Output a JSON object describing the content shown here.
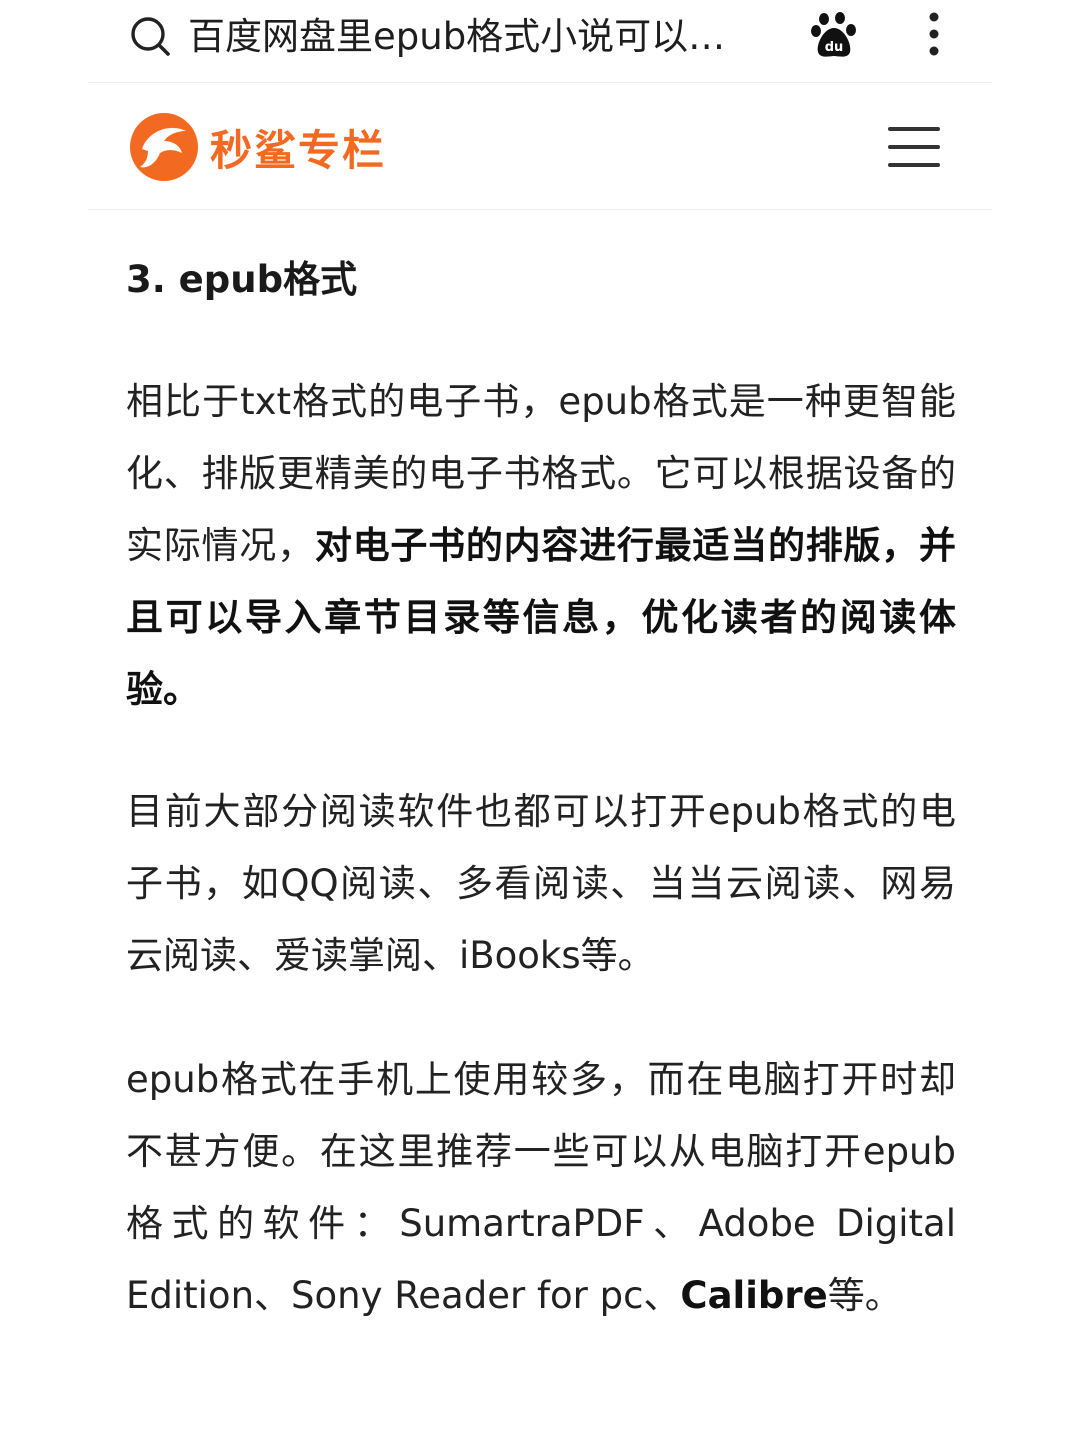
{
  "search_bar": {
    "query": "百度网盘里epub格式小说可以…",
    "icons": {
      "search": "search-icon",
      "baidu": "baidu-paw-icon",
      "more": "more-vertical-icon"
    }
  },
  "site_header": {
    "logo_text": "秒鲨专栏",
    "brand_color": "#f26a22",
    "menu_icon": "hamburger-menu-icon"
  },
  "article": {
    "heading": "3. epub格式",
    "para1": {
      "part1": "相比于txt格式的电子书，epub格式是一种更智能化、排版更精美的电子书格式。它可以根据设备的实际情况，",
      "bold": "对电子书的内容进行最适当的排版，并且可以导入章节目录等信息，优化读者的阅读体验。"
    },
    "para2": "目前大部分阅读软件也都可以打开epub格式的电子书，如QQ阅读、多看阅读、当当云阅读、网易云阅读、爱读掌阅、iBooks等。",
    "para3": {
      "part1": "epub格式在手机上使用较多，而在电脑打开时却不甚方便。在这里推荐一些可以从电脑打开epub格式的软件：SumartraPDF、Adobe Digital Edition、Sony Reader for pc、",
      "bold": "Calibre",
      "part2": "等。"
    }
  }
}
